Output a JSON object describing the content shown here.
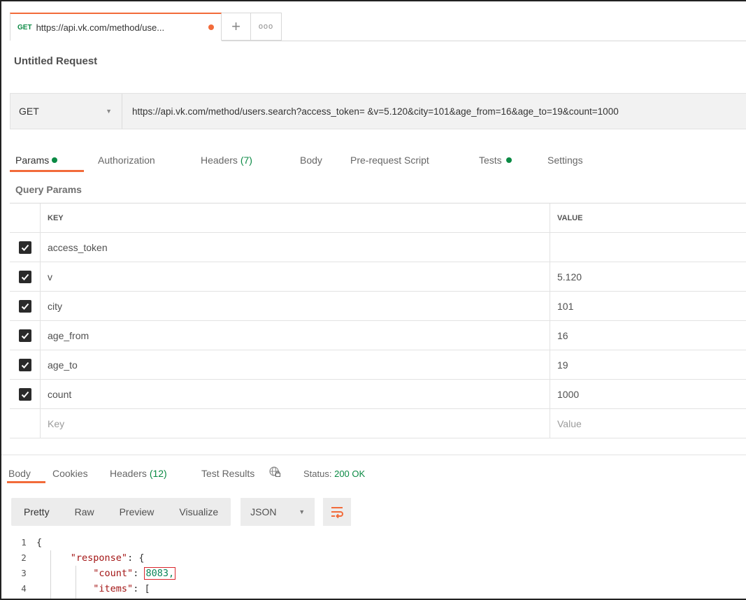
{
  "tab": {
    "method": "GET",
    "url": "https://api.vk.com/method/use...",
    "new_tab": "+",
    "more": "ooo"
  },
  "request_title": "Untitled Request",
  "url_bar": {
    "method": "GET",
    "url": "https://api.vk.com/method/users.search?access_token= &v=5.120&city=101&age_from=16&age_to=19&count=1000"
  },
  "request_tabs": {
    "params": "Params",
    "authorization": "Authorization",
    "headers": "Headers",
    "headers_count": "(7)",
    "body": "Body",
    "pre_request": "Pre-request Script",
    "tests": "Tests",
    "settings": "Settings"
  },
  "query_params": {
    "title": "Query Params",
    "key_header": "KEY",
    "value_header": "VALUE",
    "rows": [
      {
        "key": "access_token",
        "value": "",
        "checked": true
      },
      {
        "key": "v",
        "value": "5.120",
        "checked": true
      },
      {
        "key": "city",
        "value": "101",
        "checked": true
      },
      {
        "key": "age_from",
        "value": "16",
        "checked": true
      },
      {
        "key": "age_to",
        "value": "19",
        "checked": true
      },
      {
        "key": "count",
        "value": "1000",
        "checked": true
      }
    ],
    "key_placeholder": "Key",
    "value_placeholder": "Value"
  },
  "response_tabs": {
    "body": "Body",
    "cookies": "Cookies",
    "headers": "Headers",
    "headers_count": "(12)",
    "test_results": "Test Results",
    "status_label": "Status:",
    "status_value": "200 OK"
  },
  "response_toolbar": {
    "pretty": "Pretty",
    "raw": "Raw",
    "preview": "Preview",
    "visualize": "Visualize",
    "format": "JSON"
  },
  "code": {
    "line_numbers": [
      "1",
      "2",
      "3",
      "4"
    ],
    "l1": "{",
    "l2_key": "\"response\"",
    "l2_rest": ": {",
    "l3_key": "\"count\"",
    "l3_colon": ": ",
    "l3_value": "8083,",
    "l4_key": "\"items\"",
    "l4_rest": ": ["
  },
  "colors": {
    "accent": "#f26b3a",
    "success": "#0b8a44",
    "highlight_box": "#d9262c"
  }
}
